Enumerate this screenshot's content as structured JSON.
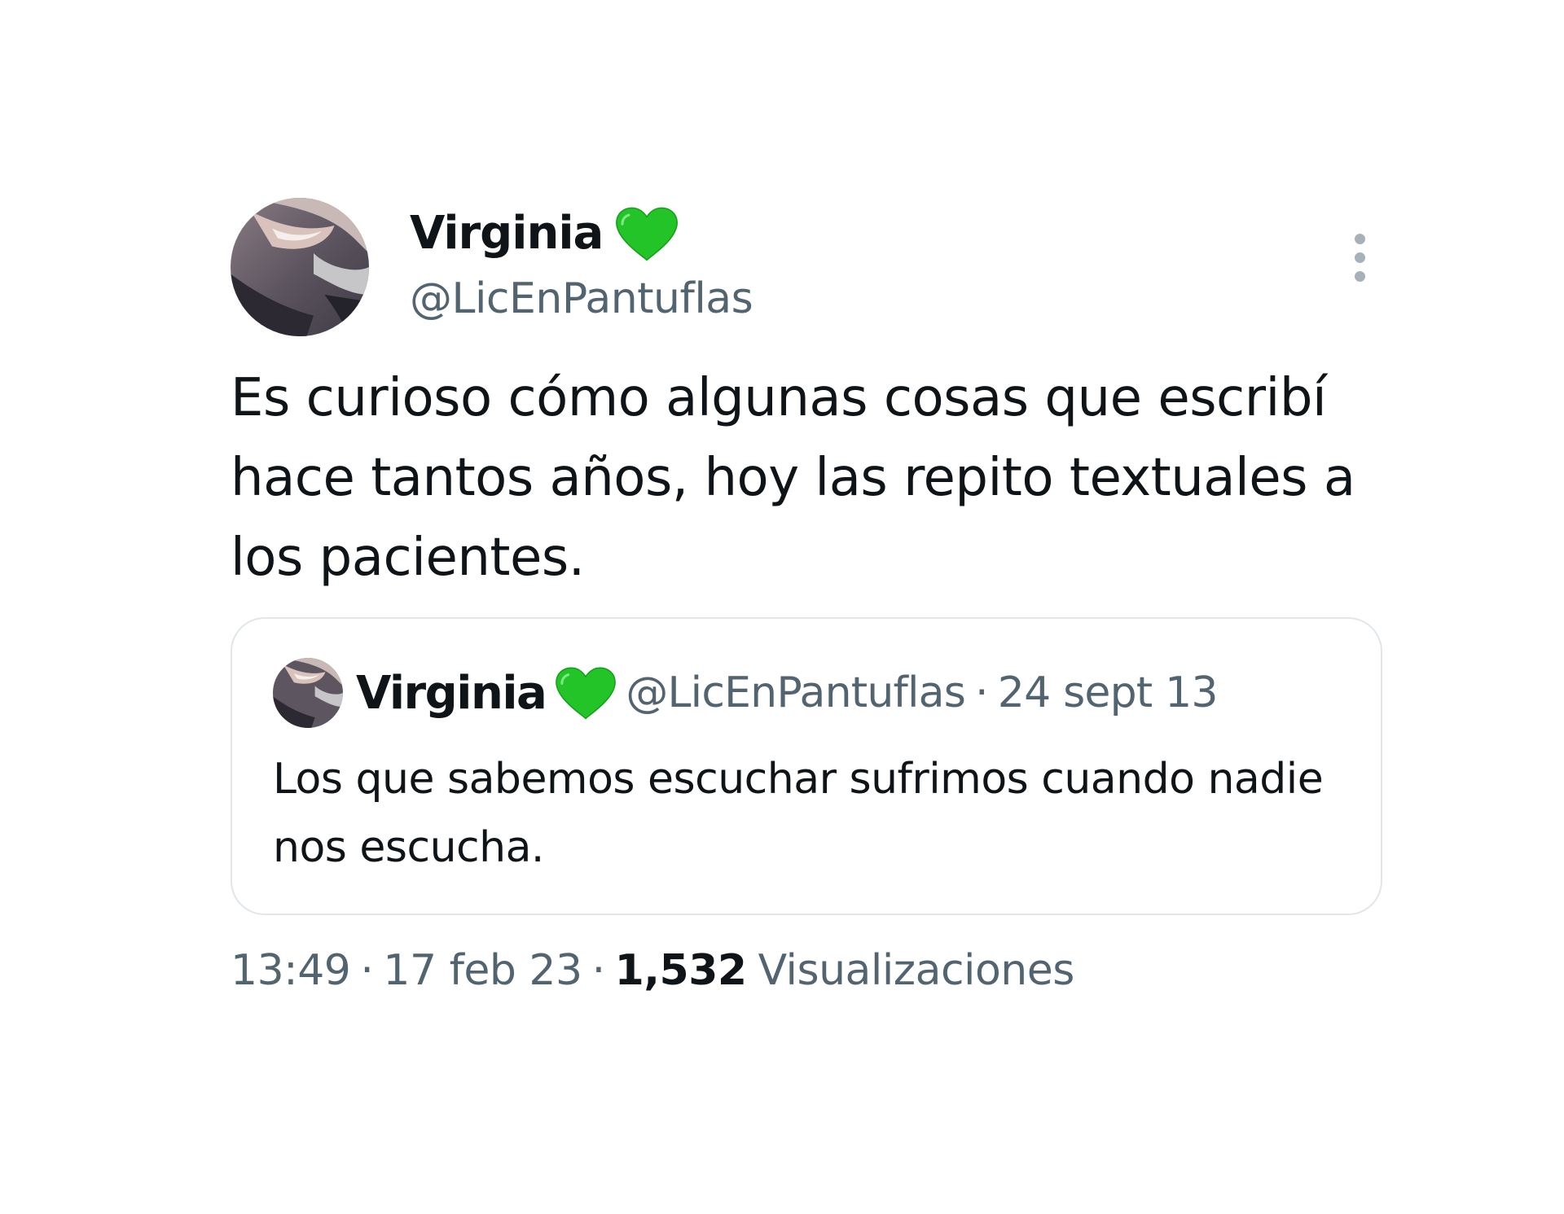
{
  "tweet": {
    "author": {
      "display_name": "Virginia",
      "handle": "@LicEnPantuflas",
      "badge_icon": "green-heart-icon"
    },
    "text": "Es curioso cómo algunas cosas que escribí hace tantos años, hoy las repito textuales a los pacientes.",
    "time": "13:49",
    "separator": "·",
    "date": "17 feb 23",
    "views_count": "1,532",
    "views_label": "Visualizaciones",
    "more_icon": "more-vertical-icon"
  },
  "quoted_tweet": {
    "author": {
      "display_name": "Virginia",
      "handle": "@LicEnPantuflas",
      "badge_icon": "green-heart-icon"
    },
    "separator": "·",
    "date": "24 sept 13",
    "text": "Los que sabemos escuchar sufrimos cuando nadie nos escucha."
  },
  "colors": {
    "heart": "#22c427",
    "secondary_text": "#536471",
    "primary_text": "#0f1419",
    "border": "#e1e6ea"
  }
}
